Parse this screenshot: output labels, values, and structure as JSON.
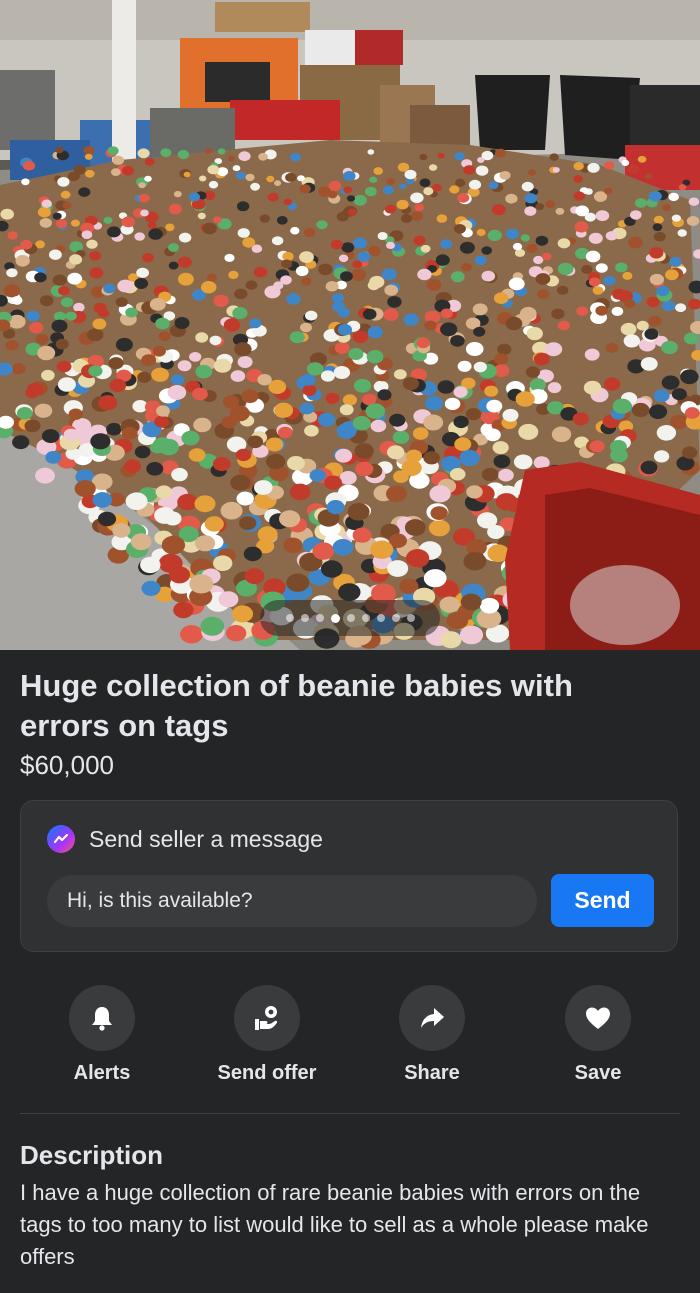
{
  "listing": {
    "title": "Huge collection of beanie babies with errors on tags",
    "price": "$60,000",
    "photo_count": 9,
    "active_photo_index": 3
  },
  "message": {
    "header": "Send seller a message",
    "input_value": "Hi, is this available?",
    "send_label": "Send"
  },
  "actions": [
    {
      "label": "Alerts",
      "icon": "bell-icon"
    },
    {
      "label": "Send offer",
      "icon": "offer-icon"
    },
    {
      "label": "Share",
      "icon": "share-arrow-icon"
    },
    {
      "label": "Save",
      "icon": "heart-icon"
    }
  ],
  "description": {
    "heading": "Description",
    "text": "I have a huge collection of rare beanie babies with errors on the tags to too many to list would like to sell as a whole please make offers"
  },
  "colors": {
    "background": "#242526",
    "card": "#303132",
    "accent": "#1877f2",
    "text": "#e4e6eb"
  }
}
